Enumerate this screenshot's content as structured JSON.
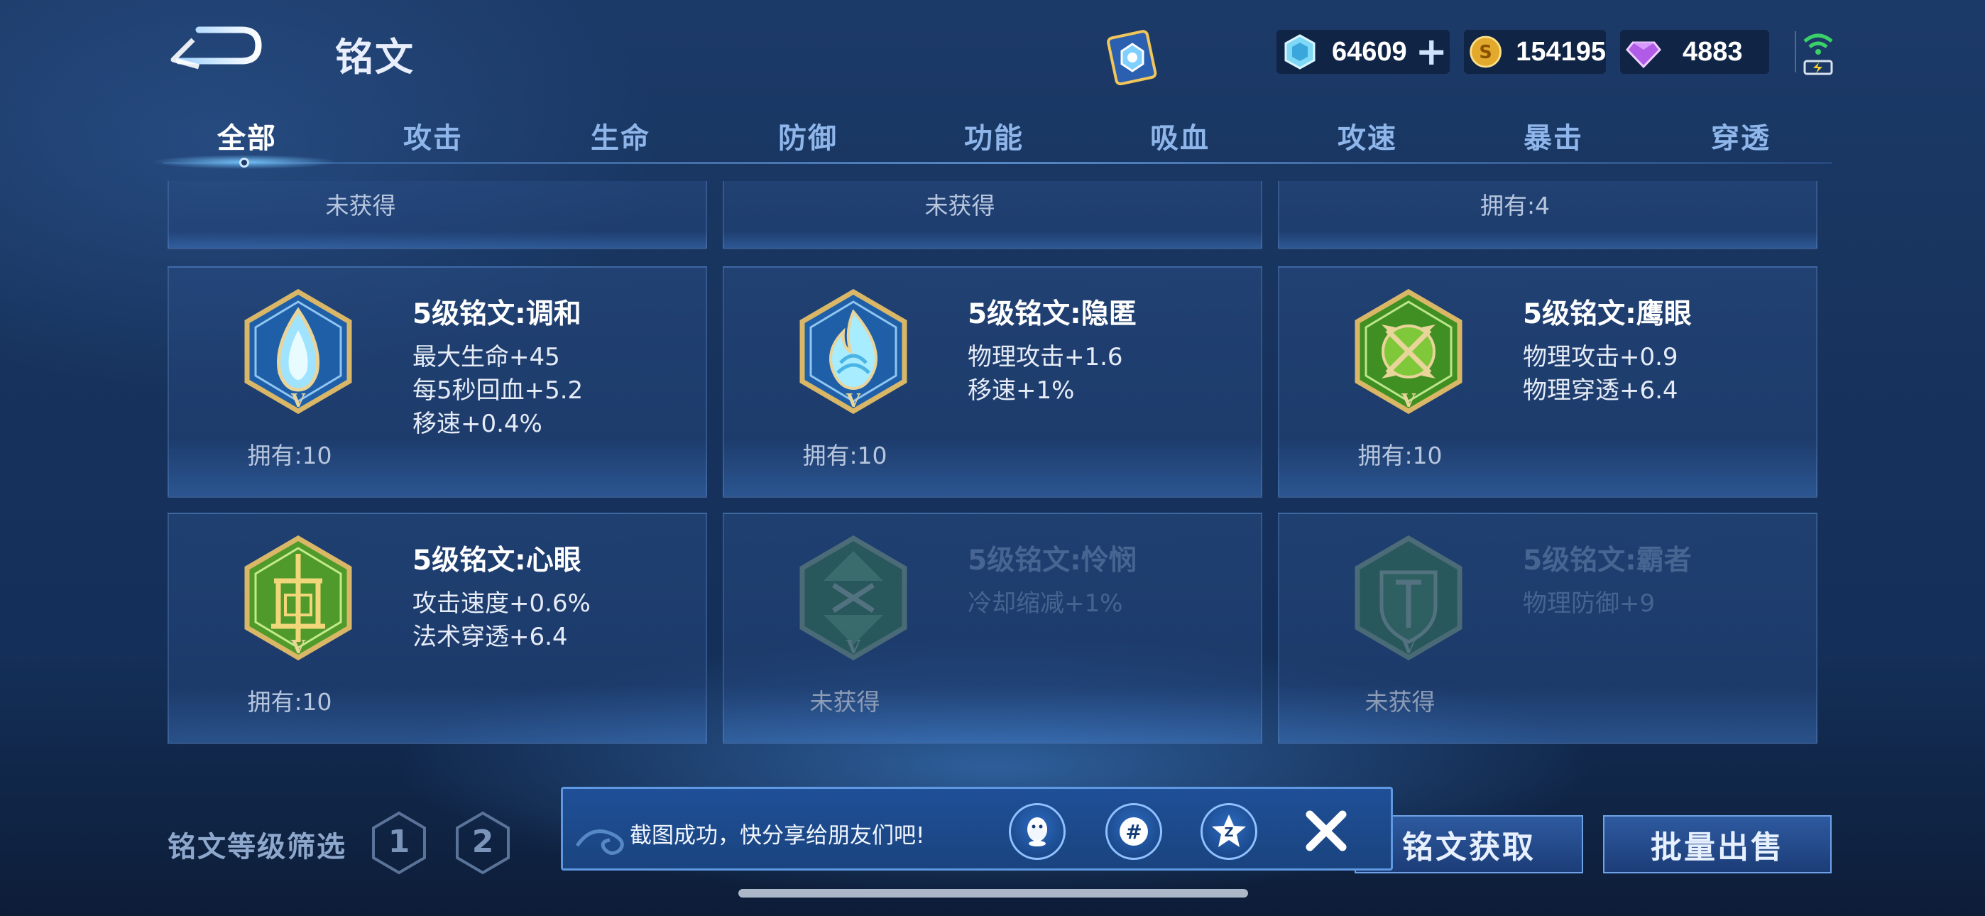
{
  "header": {
    "title": "铭文",
    "currencies": [
      {
        "icon": "crystal-icon",
        "value": "64609",
        "has_plus": true
      },
      {
        "icon": "gold-coin-icon",
        "value": "154195"
      },
      {
        "icon": "diamond-icon",
        "value": "4883"
      }
    ]
  },
  "tabs": [
    "全部",
    "攻击",
    "生命",
    "防御",
    "功能",
    "吸血",
    "攻速",
    "暴击",
    "穿透"
  ],
  "active_tab": "全部",
  "top_cards": [
    {
      "owned": "未获得"
    },
    {
      "owned": "未获得"
    },
    {
      "owned": "拥有:4"
    }
  ],
  "cards": [
    {
      "title": "5级铭文:调和",
      "stats": [
        "最大生命+45",
        "每5秒回血+5.2",
        "移速+0.4%"
      ],
      "owned": "拥有:10",
      "icon": "teardrop-emblem-icon",
      "color": "#2f7fc8",
      "level_mark": "V"
    },
    {
      "title": "5级铭文:隐匿",
      "stats": [
        "物理攻击+1.6",
        "移速+1%"
      ],
      "owned": "拥有:10",
      "icon": "flame-emblem-icon",
      "color": "#2f7fc8",
      "level_mark": "V"
    },
    {
      "title": "5级铭文:鹰眼",
      "stats": [
        "物理攻击+0.9",
        "物理穿透+6.4"
      ],
      "owned": "拥有:10",
      "icon": "arrows-emblem-icon",
      "color": "#4f9a2a",
      "level_mark": "V"
    },
    {
      "title": "5级铭文:心眼",
      "stats": [
        "攻击速度+0.6%",
        "法术穿透+6.4"
      ],
      "owned": "拥有:10",
      "icon": "gate-emblem-icon",
      "color": "#4f9a2a",
      "level_mark": "V"
    },
    {
      "title": "5级铭文:怜悯",
      "stats": [
        "冷却缩减+1%"
      ],
      "owned": "未获得",
      "icon": "hourglass-emblem-icon",
      "color": "#3f8a3a",
      "level_mark": "V",
      "locked": true
    },
    {
      "title": "5级铭文:霸者",
      "stats": [
        "物理防御+9"
      ],
      "owned": "未获得",
      "icon": "shield-emblem-icon",
      "color": "#3f8a3a",
      "level_mark": "V",
      "locked": true
    }
  ],
  "bottom": {
    "filter_label": "铭文等级筛选",
    "levels": [
      "1",
      "2"
    ],
    "get_button": "铭文获取",
    "sell_button": "批量出售"
  },
  "toast": {
    "message": "截图成功，快分享给朋友们吧!",
    "share_icons": [
      "qq-icon",
      "wechat-moments-icon",
      "qzone-icon"
    ]
  }
}
